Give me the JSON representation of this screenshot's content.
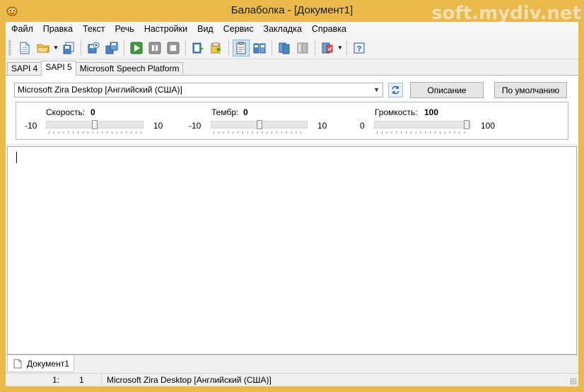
{
  "window": {
    "title": "Балаболка - [Документ1]",
    "watermark": "soft.mydiv.net",
    "frame_color": "#e9b94c"
  },
  "menu": [
    "Файл",
    "Правка",
    "Текст",
    "Речь",
    "Настройки",
    "Вид",
    "Сервис",
    "Закладка",
    "Справка"
  ],
  "toolbar": {
    "buttons": [
      "new-document-icon",
      "open-folder-icon",
      "save-icon",
      "save-audio-icon",
      "batch-convert-icon",
      "play-icon",
      "pause-icon",
      "stop-icon",
      "read-clipboard-icon",
      "read-file-icon",
      "clipboard-monitor-icon",
      "book-icon",
      "split-file-icon",
      "compare-icon",
      "spelling-icon",
      "help-icon"
    ]
  },
  "tabs": [
    {
      "label": "SAPI 4",
      "active": false
    },
    {
      "label": "SAPI 5",
      "active": true
    },
    {
      "label": "Microsoft Speech Platform",
      "active": false
    }
  ],
  "voice": {
    "selected": "Microsoft Zira Desktop [Английский (США)]",
    "description_button": "Описание",
    "default_button": "По умолчанию"
  },
  "params": {
    "speed": {
      "label": "Скорость:",
      "value": "0",
      "min": "-10",
      "max": "10",
      "level": 0.5
    },
    "pitch": {
      "label": "Тембр:",
      "value": "0",
      "min": "-10",
      "max": "10",
      "level": 0.5
    },
    "volume": {
      "label": "Громкость:",
      "value": "100",
      "min": "0",
      "max": "100",
      "level": 1.0
    }
  },
  "document_tab": {
    "label": "Документ1"
  },
  "statusbar": {
    "line": "1:",
    "column": "1",
    "voice": "Microsoft Zira Desktop [Английский (США)]"
  }
}
